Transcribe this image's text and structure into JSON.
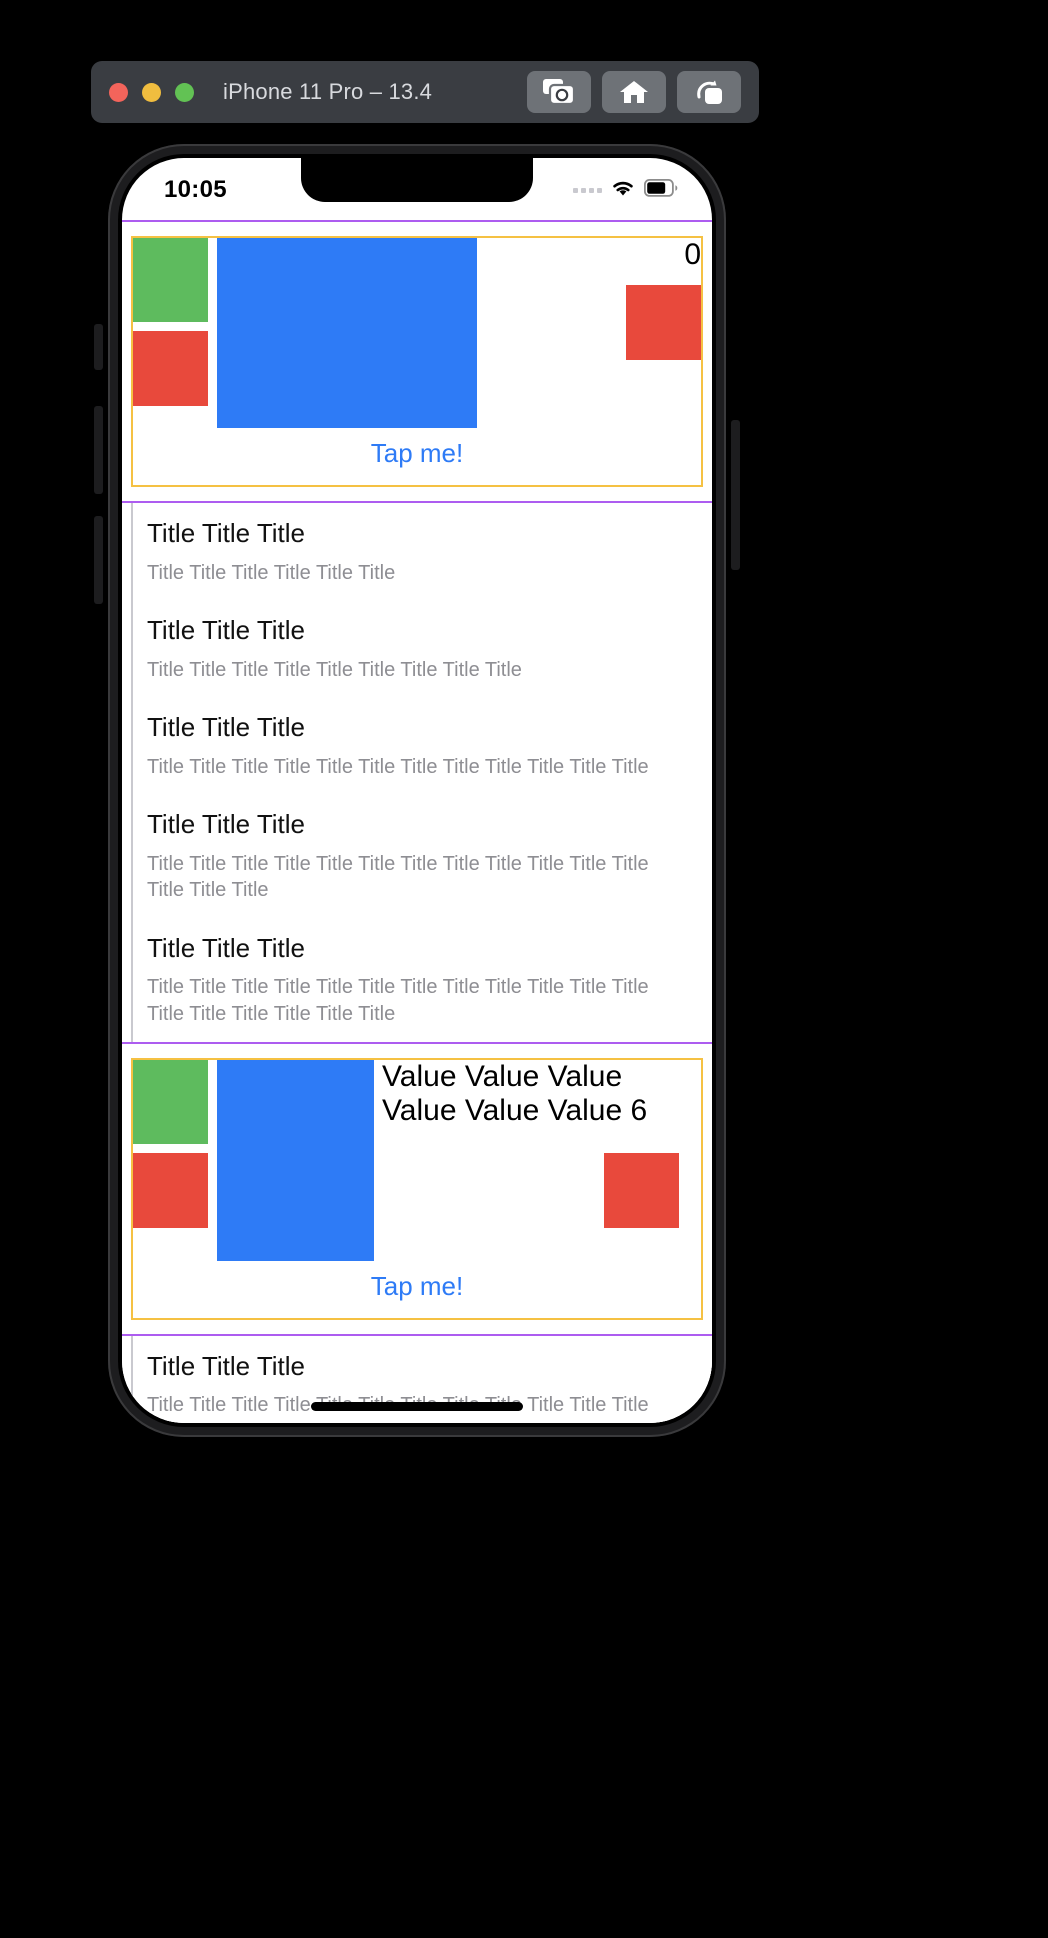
{
  "simulator": {
    "title": "iPhone 11 Pro – 13.4",
    "traffic_lights": [
      {
        "name": "close",
        "color": "#f3645b"
      },
      {
        "name": "minimize",
        "color": "#f0bd3f"
      },
      {
        "name": "zoom",
        "color": "#62c254"
      }
    ],
    "toolbar": [
      {
        "name": "screenshot-button",
        "icon": "camera-icon"
      },
      {
        "name": "home-button",
        "icon": "home-icon"
      },
      {
        "name": "rotate-button",
        "icon": "rotate-device-icon"
      }
    ]
  },
  "status_bar": {
    "time": "10:05",
    "signal_icon": "signal-dots-icon",
    "wifi_icon": "wifi-icon",
    "battery_icon": "battery-icon"
  },
  "cards": [
    {
      "count_label": "0",
      "tap_label": "Tap me!",
      "border_color": "#f5c143",
      "outline_color": "#ad5cf0"
    },
    {
      "count_label": "Value Value Value Value Value Value 6",
      "tap_label": "Tap me!",
      "border_color": "#f5c143",
      "outline_color": "#ad5cf0"
    }
  ],
  "shapes": {
    "green": "#5ebb5e",
    "red": "#e8493c",
    "blue": "#2e7bf6"
  },
  "list_top": [
    {
      "title": "Title Title Title",
      "subtitle": "Title Title Title  Title Title Title"
    },
    {
      "title": "Title Title Title",
      "subtitle": "Title Title Title  Title Title Title  Title Title Title"
    },
    {
      "title": "Title Title Title",
      "subtitle": "Title Title Title  Title Title Title  Title Title Title  Title Title Title"
    },
    {
      "title": "Title Title Title",
      "subtitle": "Title Title Title  Title Title Title  Title Title Title  Title Title Title  Title Title Title"
    },
    {
      "title": "Title Title Title",
      "subtitle": "Title Title Title  Title Title Title  Title Title Title  Title Title Title  Title Title Title  Title Title Title"
    }
  ],
  "list_bottom": [
    {
      "title": "Title Title Title",
      "subtitle": "Title Title Title  Title Title Title  Title Title Title  Title Title Title"
    }
  ]
}
